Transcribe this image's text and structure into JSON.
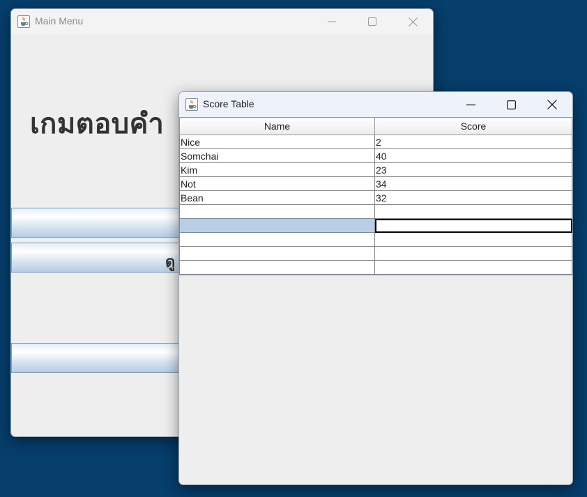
{
  "main_window": {
    "title": "Main Menu",
    "heading": "เกมตอบคำ",
    "buttons": [
      "",
      "ดู",
      ""
    ]
  },
  "score_window": {
    "title": "Score Table",
    "columns": [
      "Name",
      "Score"
    ],
    "rows": [
      [
        "Nice",
        "2"
      ],
      [
        "Somchai",
        "40"
      ],
      [
        "Kim",
        "23"
      ],
      [
        "Not",
        "34"
      ],
      [
        "Bean",
        "32"
      ],
      [
        "",
        ""
      ],
      [
        "",
        ""
      ],
      [
        "",
        ""
      ],
      [
        "",
        ""
      ],
      [
        "",
        ""
      ]
    ],
    "selected_row_index": 6
  },
  "colors": {
    "desktop": "#063e6c",
    "selection": "#b8cfe5"
  },
  "icons": {
    "app_icon": "java-coffee-cup-icon",
    "minimize": "minimize-icon",
    "maximize": "maximize-icon",
    "close": "close-icon"
  }
}
